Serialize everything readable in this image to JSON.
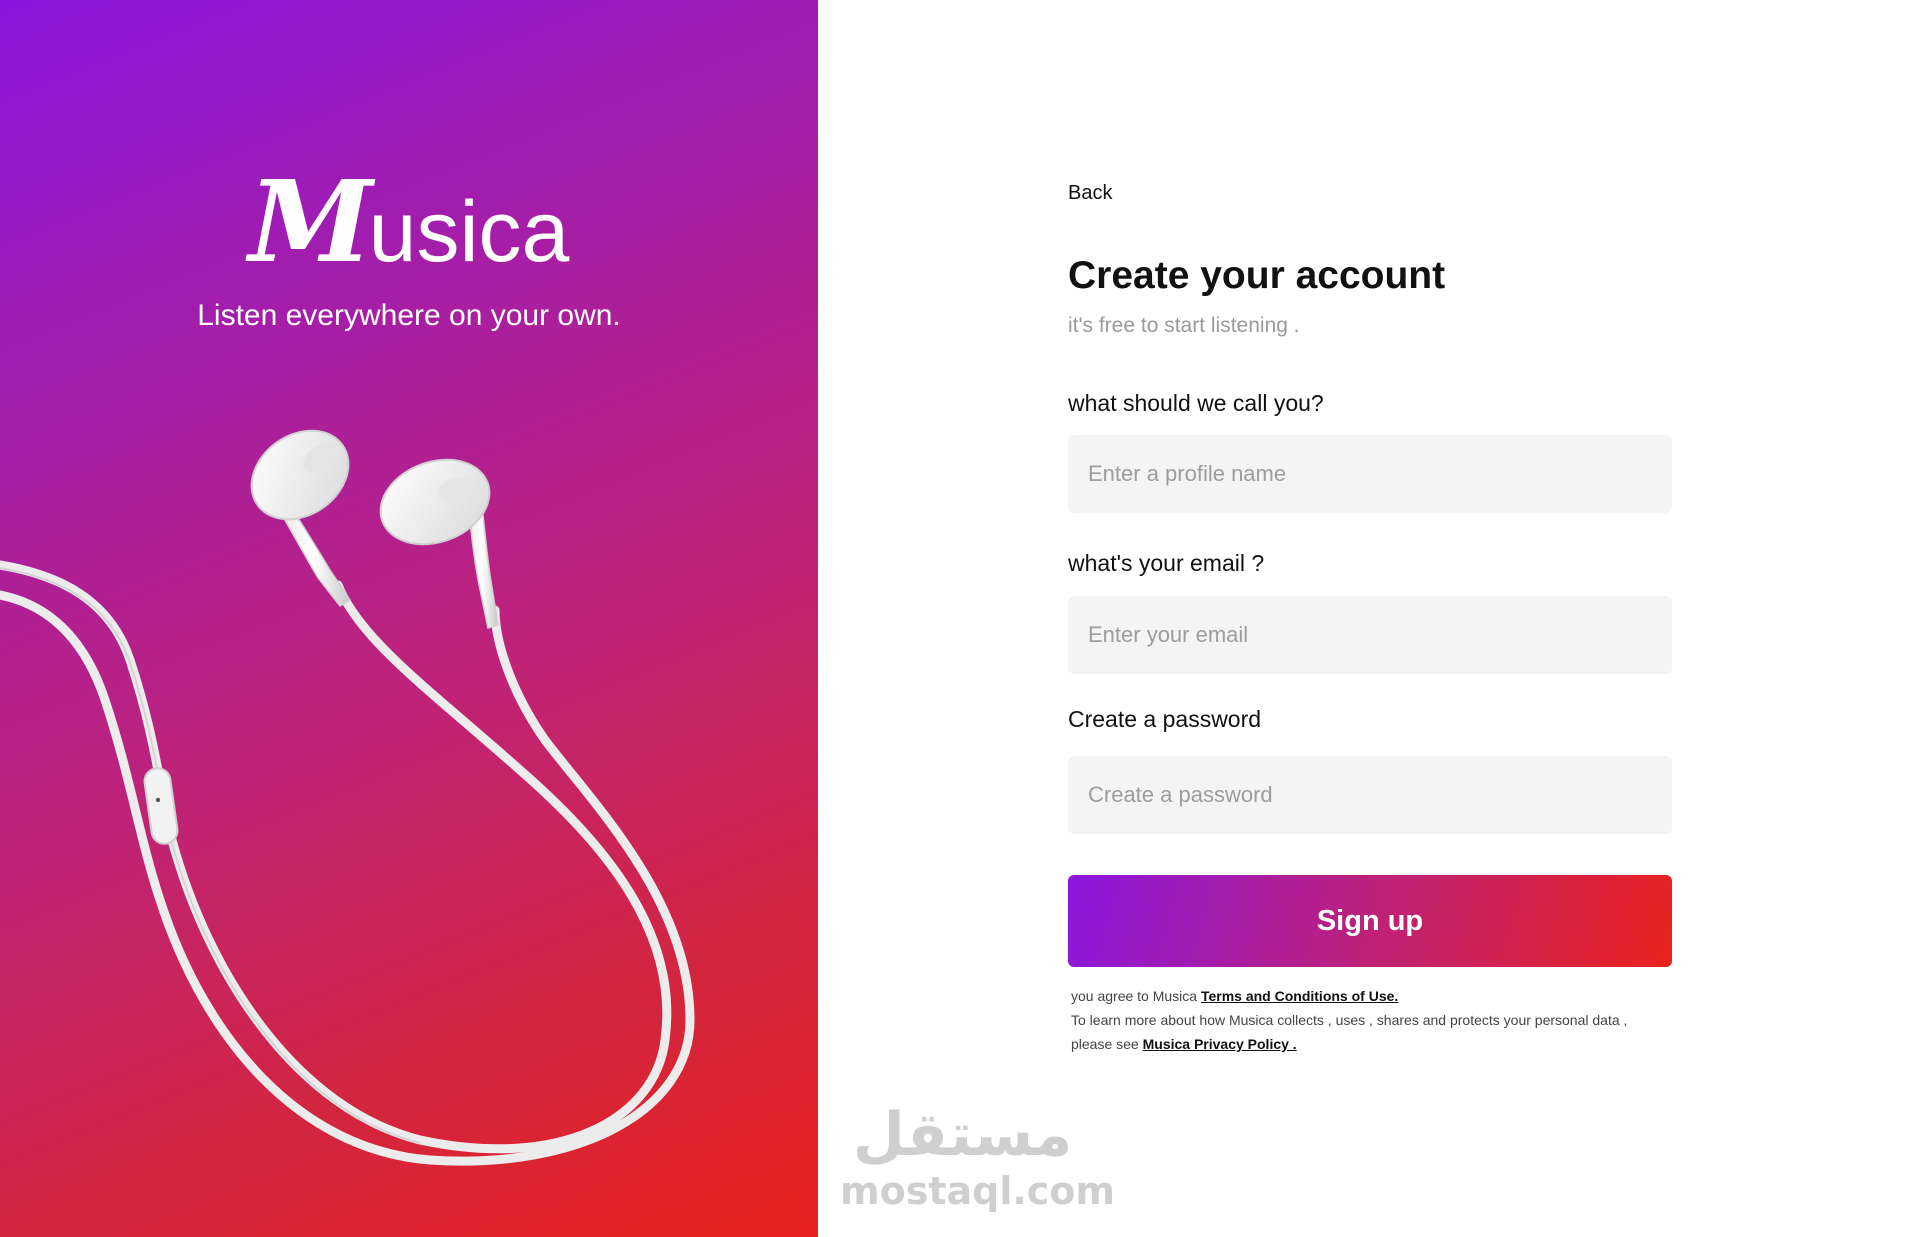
{
  "brand": {
    "logo_initial": "M",
    "logo_rest": "usica",
    "tagline": "Listen everywhere on your own."
  },
  "hero": {
    "image": "white-earphones",
    "gradient_colors": [
      "#8a17de",
      "#bf2378",
      "#e8221d"
    ]
  },
  "nav": {
    "back_label": "Back"
  },
  "form": {
    "title": "Create your account",
    "subtitle": "it's free to start listening .",
    "name_label": "what should we call you?",
    "name_placeholder": "Enter a profile name",
    "email_label": "what's your email ?",
    "email_placeholder": "Enter your email",
    "password_label": "Create a password",
    "password_placeholder": "Create a password",
    "submit_label": "Sign up"
  },
  "legal": {
    "line1_prefix": "you agree to Musica ",
    "terms_link": "Terms and Conditions of Use.",
    "line2_prefix": "To learn more about how Musica collects , uses , shares and protects your personal data , please see ",
    "privacy_link": "Musica Privacy Policy ."
  },
  "watermark": {
    "glyphs": "مستقل",
    "text": "mostaql.com"
  },
  "colors": {
    "accent_start": "#8917df",
    "accent_end": "#e9231d",
    "input_bg": "#f4f4f4",
    "muted_text": "#9a9a9a"
  }
}
